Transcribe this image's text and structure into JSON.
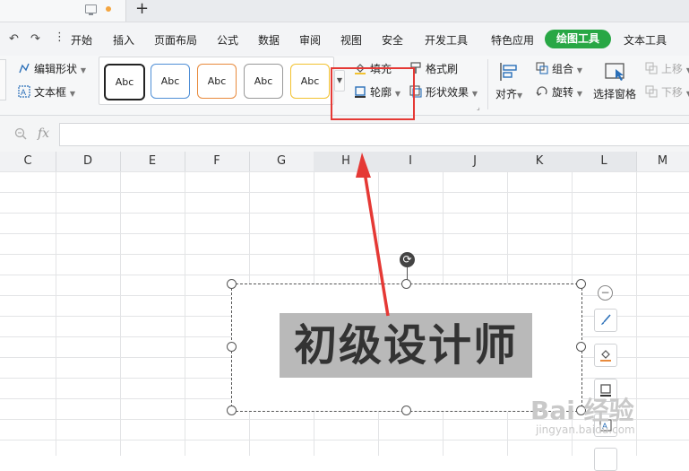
{
  "menu": {
    "items": [
      "开始",
      "插入",
      "页面布局",
      "公式",
      "数据",
      "审阅",
      "视图",
      "安全",
      "开发工具",
      "特色应用"
    ],
    "active": "绘图工具",
    "after_active": "文本工具"
  },
  "ribbon": {
    "edit_shape": "编辑形状",
    "text_box": "文本框",
    "style_label": "Abc",
    "fill": "填充",
    "format_painter": "格式刷",
    "outline": "轮廓",
    "shape_effect": "形状效果",
    "align": "对齐",
    "group": "组合",
    "rotate": "旋转",
    "selection_pane": "选择窗格",
    "bring_forward": "上移",
    "send_backward": "下移"
  },
  "formula_bar": {
    "fx": "fx",
    "value": ""
  },
  "columns": [
    "C",
    "D",
    "E",
    "F",
    "G",
    "H",
    "I",
    "J",
    "K",
    "L",
    "M"
  ],
  "shape": {
    "text": "初级设计师"
  },
  "watermark": {
    "brand": "Bai 经验",
    "url": "jingyan.baidu.com"
  },
  "colors": {
    "active_tab": "#28a745",
    "annotation": "#e53935"
  }
}
